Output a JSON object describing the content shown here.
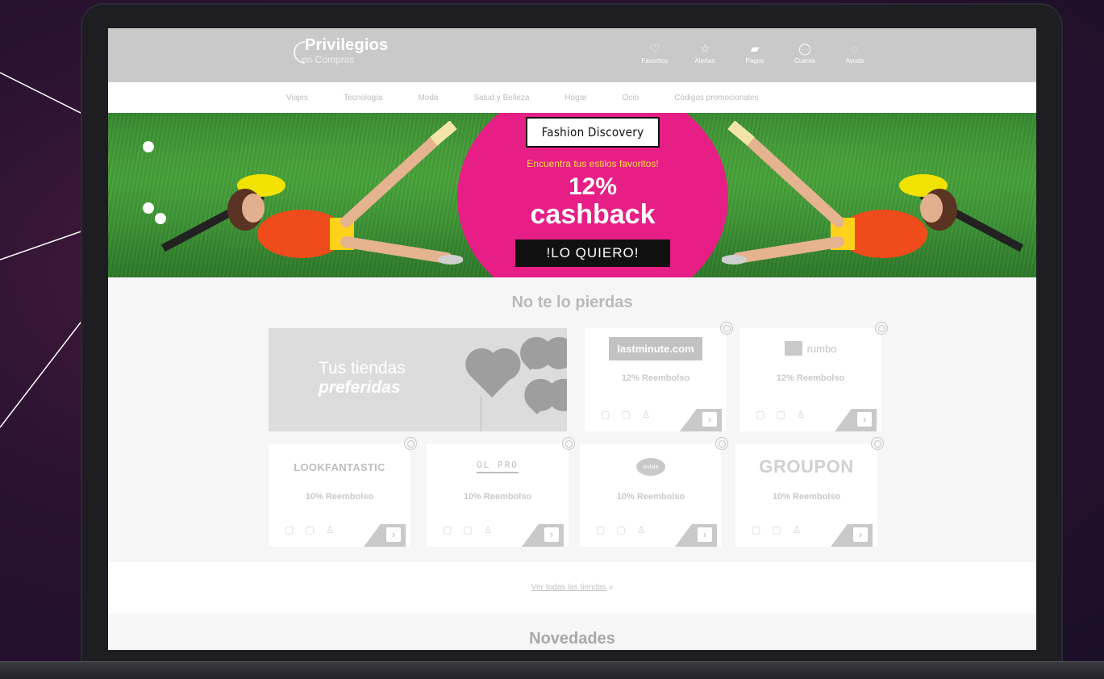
{
  "header": {
    "logo_main": "Privilegios",
    "logo_sub": "en Compras",
    "icons": [
      {
        "icon": "heart-icon",
        "label": "Favoritos"
      },
      {
        "icon": "star-icon",
        "label": "Alertas"
      },
      {
        "icon": "wallet-icon",
        "label": "Pagos"
      },
      {
        "icon": "user-icon",
        "label": "Cuenta"
      },
      {
        "icon": "help-icon",
        "label": "Ayuda"
      }
    ]
  },
  "nav": [
    "Viajes",
    "Tecnología",
    "Moda",
    "Salud y Belleza",
    "Hogar",
    "Ocio",
    "Códigos promocionales"
  ],
  "banner": {
    "brand": "Fashion Discovery",
    "tagline": "Encuentra tus estilos favoritos!",
    "percent": "12%",
    "cashback": "cashback",
    "cta": "!LO QUIERO!",
    "circle_color": "#e61e86",
    "tagline_color": "#ffe23a"
  },
  "section": {
    "title": "No te lo pierdas",
    "promo_line1": "Tus tiendas",
    "promo_line2": "preferidas",
    "cards": [
      {
        "name": "lastminute.com",
        "rate": "12% Reembolso"
      },
      {
        "name": "rumbo",
        "rate": "12% Reembolso"
      },
      {
        "name": "LOOKFANTASTIC",
        "rate": "10% Reembolso"
      },
      {
        "name": "OL PRO",
        "rate": "10% Reembolso"
      },
      {
        "name": "oulala",
        "rate": "10% Reembolso"
      },
      {
        "name": "GROUPON",
        "rate": "10% Reembolso"
      }
    ]
  },
  "view_all": {
    "label": "Ver todas las tiendas",
    "arrow": "»"
  },
  "next_section": {
    "title": "Novedades"
  }
}
